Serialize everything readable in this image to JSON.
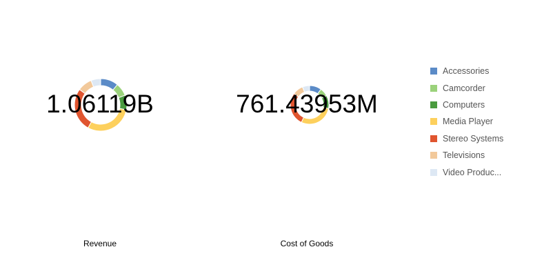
{
  "chart_data": [
    {
      "type": "pie",
      "style": "donut",
      "value_label": "1.06119B",
      "caption": "Revenue",
      "categories": [
        "Accessories",
        "Camcorder",
        "Computers",
        "Media Player",
        "Stereo Systems",
        "Televisions",
        "Video Produc..."
      ],
      "values": [
        0.11,
        0.08,
        0.09,
        0.3,
        0.27,
        0.09,
        0.06
      ]
    },
    {
      "type": "pie",
      "style": "donut",
      "value_label": "761.43953M",
      "caption": "Cost of Goods",
      "categories": [
        "Accessories",
        "Camcorder",
        "Computers",
        "Media Player",
        "Stereo Systems",
        "Televisions",
        "Video Produc..."
      ],
      "values": [
        0.1,
        0.07,
        0.11,
        0.29,
        0.28,
        0.09,
        0.06
      ]
    }
  ],
  "legend": {
    "placement": "right",
    "items": [
      {
        "label": "Accessories",
        "color": "#5b8bc7"
      },
      {
        "label": "Camcorder",
        "color": "#9bd27b"
      },
      {
        "label": "Computers",
        "color": "#4a9b3f"
      },
      {
        "label": "Media Player",
        "color": "#fdd05d"
      },
      {
        "label": "Stereo Systems",
        "color": "#e0552f"
      },
      {
        "label": "Televisions",
        "color": "#f2c99b"
      },
      {
        "label": "Video Produc...",
        "color": "#dde8f4"
      }
    ]
  }
}
